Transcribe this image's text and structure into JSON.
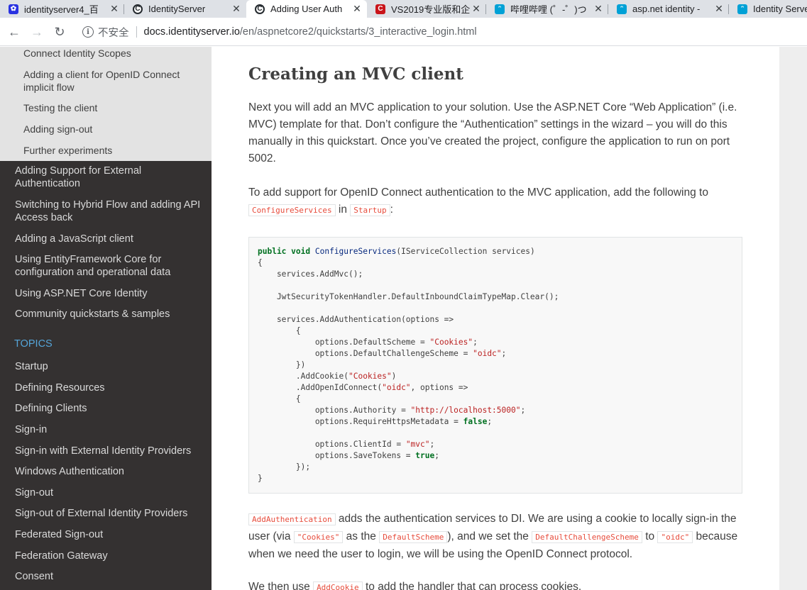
{
  "tabs": [
    {
      "title": "identityserver4_百",
      "icon": "baidu-icon",
      "color": "#2932e1"
    },
    {
      "title": "IdentityServer",
      "icon": "github-icon",
      "color": "#24292e"
    },
    {
      "title": "Adding User Auth",
      "icon": "github-icon",
      "color": "#24292e",
      "active": true
    },
    {
      "title": "VS2019专业版和企",
      "icon": "csdn-icon",
      "color": "#c9141a"
    },
    {
      "title": "哔哩哔哩 (゜-゜)つ",
      "icon": "bilibili-icon",
      "color": "#00a1d6"
    },
    {
      "title": "asp.net identity -",
      "icon": "bilibili-icon",
      "color": "#00a1d6"
    },
    {
      "title": "Identity Server",
      "icon": "bilibili-icon",
      "color": "#00a1d6"
    }
  ],
  "tab_close": "✕",
  "address": {
    "secure_label": "不安全",
    "host": "docs.identityserver.io",
    "path": "/en/aspnetcore2/quickstarts/3_interactive_login.html"
  },
  "sidebar": {
    "sub_items": [
      "Connect Identity Scopes",
      "Adding a client for OpenID Connect implicit flow",
      "Testing the client",
      "Adding sign-out",
      "Further experiments"
    ],
    "items": [
      "Adding Support for External Authentication",
      "Switching to Hybrid Flow and adding API Access back",
      "Adding a JavaScript client",
      "Using EntityFramework Core for configuration and operational data",
      "Using ASP.NET Core Identity",
      "Community quickstarts & samples"
    ],
    "caption": "TOPICS",
    "topics": [
      "Startup",
      "Defining Resources",
      "Defining Clients",
      "Sign-in",
      "Sign-in with External Identity Providers",
      "Windows Authentication",
      "Sign-out",
      "Sign-out of External Identity Providers",
      "Federated Sign-out",
      "Federation Gateway",
      "Consent"
    ]
  },
  "content": {
    "heading": "Creating an MVC client",
    "p1": "Next you will add an MVC application to your solution. Use the ASP.NET Core “Web Application” (i.e. MVC) template for that. Don’t configure the “Authentication” settings in the wizard – you will do this manually in this quickstart. Once you’ve created the project, configure the application to run on port 5002.",
    "p2_a": "To add support for OpenID Connect authentication to the MVC application, add the following to",
    "p2_code1": "ConfigureServices",
    "p2_b": "in",
    "p2_code2": "Startup",
    "p2_c": ":",
    "p3_code1": "AddAuthentication",
    "p3_a": "adds the authentication services to DI. We are using a cookie to locally sign-in the user (via",
    "p3_code2": "\"Cookies\"",
    "p3_b": "as the",
    "p3_code3": "DefaultScheme",
    "p3_c": "), and we set the",
    "p3_code4": "DefaultChallengeScheme",
    "p3_d": "to",
    "p3_code5": "\"oidc\"",
    "p3_e": "because when we need the user to login, we will be using the OpenID Connect protocol.",
    "p4_a": "We then use",
    "p4_code1": "AddCookie",
    "p4_b": "to add the handler that can process cookies."
  },
  "code": {
    "kw_public": "public",
    "kw_void": "void",
    "method": "ConfigureServices",
    "l1_rest": "(IServiceCollection services)",
    "l2": "{",
    "l3": "    services.AddMvc();",
    "l5": "    JwtSecurityTokenHandler.DefaultInboundClaimTypeMap.Clear();",
    "l7": "    services.AddAuthentication(options =>",
    "l8": "        {",
    "l9a": "            options.DefaultScheme = ",
    "l9s": "\"Cookies\"",
    "l10a": "            options.DefaultChallengeScheme = ",
    "l10s": "\"oidc\"",
    "l11": "        })",
    "l12a": "        .AddCookie(",
    "l12s": "\"Cookies\"",
    "l12b": ")",
    "l13a": "        .AddOpenIdConnect(",
    "l13s": "\"oidc\"",
    "l13b": ", options =>",
    "l14": "        {",
    "l15a": "            options.Authority = ",
    "l15s": "\"http://localhost:5000\"",
    "l16a": "            options.RequireHttpsMetadata = ",
    "l16k": "false",
    "l18a": "            options.ClientId = ",
    "l18s": "\"mvc\"",
    "l19a": "            options.SaveTokens = ",
    "l19k": "true",
    "l20": "        });",
    "l21": "}",
    "semi": ";"
  }
}
